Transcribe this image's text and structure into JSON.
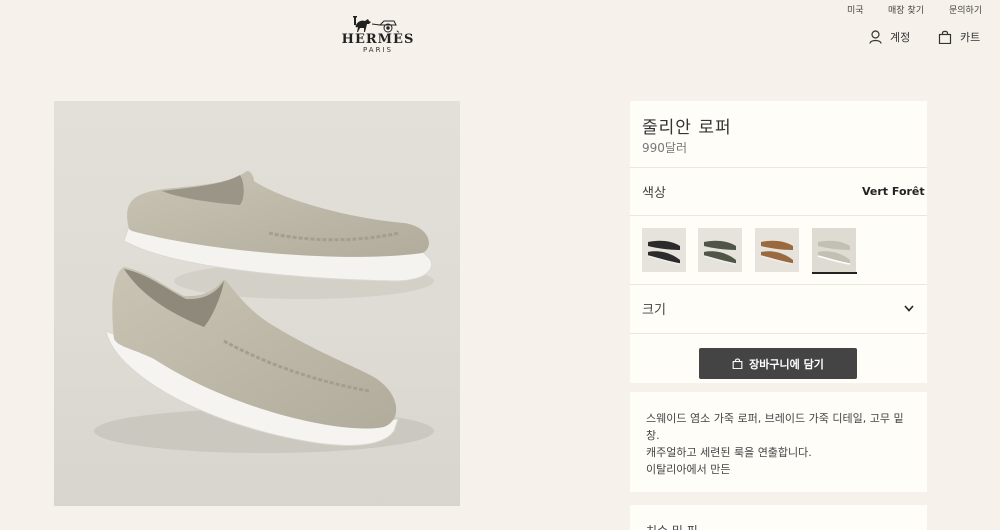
{
  "utility_nav": {
    "country": "미국",
    "store_finder": "매장 찾기",
    "contact": "문의하기"
  },
  "logo": {
    "wordmark": "HERMÈS",
    "subtitle": "PARIS"
  },
  "header": {
    "account_label": "계정",
    "cart_label": "카트",
    "account_icon": "user-icon",
    "cart_icon": "shopping-bag-icon"
  },
  "product": {
    "name": "줄리안 로퍼",
    "price": "990달러",
    "color_label": "색상",
    "color_value": "Vert Forêt",
    "size_label": "크기",
    "add_to_cart": "장바구니에 담기",
    "description": [
      "스웨이드 염소 가죽 로퍼, 브레이드 가죽 디테일, 고무 밑창.",
      "캐주얼하고 세련된 룩을 연출합니다.",
      "이탈리아에서 만든"
    ],
    "next_section_label": "치수 및 핏",
    "swatches": [
      {
        "name": "black",
        "color": "#2b2b2b"
      },
      {
        "name": "vert-foret",
        "color": "#4f5648"
      },
      {
        "name": "tan",
        "color": "#9a6a3e"
      },
      {
        "name": "light-grey",
        "color": "#d6d2c6"
      }
    ]
  },
  "colors": {
    "page_background": "#f6f1eb",
    "panel_background": "#fffdf8",
    "button_background": "#444444",
    "accent_text": "#222222"
  }
}
